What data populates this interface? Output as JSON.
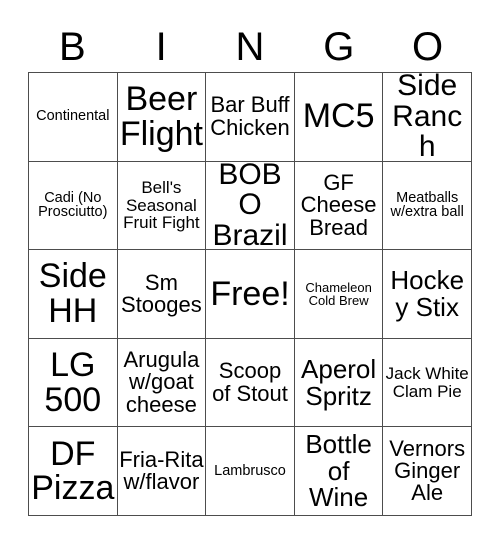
{
  "card": {
    "title": "Bingo Card",
    "header_letters": [
      "B",
      "I",
      "N",
      "G",
      "O"
    ],
    "columns": 5,
    "rows": 5,
    "free_space_label": "Free!",
    "free_space_position": "N3",
    "colors": {
      "background": "#ffffff",
      "text": "#000000",
      "grid_line": "#4d4d4d"
    },
    "cells": [
      {
        "id": "B1",
        "text": "Continental",
        "size": "xs"
      },
      {
        "id": "I1",
        "text": "Beer Flight",
        "size": "xxl"
      },
      {
        "id": "N1",
        "text": "Bar Buff Chicken",
        "size": "md"
      },
      {
        "id": "G1",
        "text": "MC5",
        "size": "xxl"
      },
      {
        "id": "O1",
        "text": "Side Ranch",
        "size": "xl"
      },
      {
        "id": "B2",
        "text": "Cadi (No Prosciutto)",
        "size": "xs"
      },
      {
        "id": "I2",
        "text": "Bell's Seasonal Fruit Fight",
        "size": "sm"
      },
      {
        "id": "N2",
        "text": "BOBO Brazil",
        "size": "xl"
      },
      {
        "id": "G2",
        "text": "GF Cheese Bread",
        "size": "md"
      },
      {
        "id": "O2",
        "text": "Meatballs w/extra ball",
        "size": "xs"
      },
      {
        "id": "B3",
        "text": "Side HH",
        "size": "xxl"
      },
      {
        "id": "I3",
        "text": "Sm Stooges",
        "size": "md"
      },
      {
        "id": "N3",
        "text": "Free!",
        "size": "xxl"
      },
      {
        "id": "G3",
        "text": "Chameleon Cold Brew",
        "size": "xxs"
      },
      {
        "id": "O3",
        "text": "Hockey Stix",
        "size": "lg"
      },
      {
        "id": "B4",
        "text": "LG 500",
        "size": "xxl"
      },
      {
        "id": "I4",
        "text": "Arugula w/goat cheese",
        "size": "md"
      },
      {
        "id": "N4",
        "text": "Scoop of Stout",
        "size": "md"
      },
      {
        "id": "G4",
        "text": "Aperol Spritz",
        "size": "lg"
      },
      {
        "id": "O4",
        "text": "Jack White Clam Pie",
        "size": "sm"
      },
      {
        "id": "B5",
        "text": "DF Pizza",
        "size": "xxl"
      },
      {
        "id": "I5",
        "text": "Fria-Rita w/flavor",
        "size": "md"
      },
      {
        "id": "N5",
        "text": "Lambrusco",
        "size": "xs"
      },
      {
        "id": "G5",
        "text": "Bottle of Wine",
        "size": "lg"
      },
      {
        "id": "O5",
        "text": "Vernors Ginger Ale",
        "size": "md"
      }
    ]
  }
}
